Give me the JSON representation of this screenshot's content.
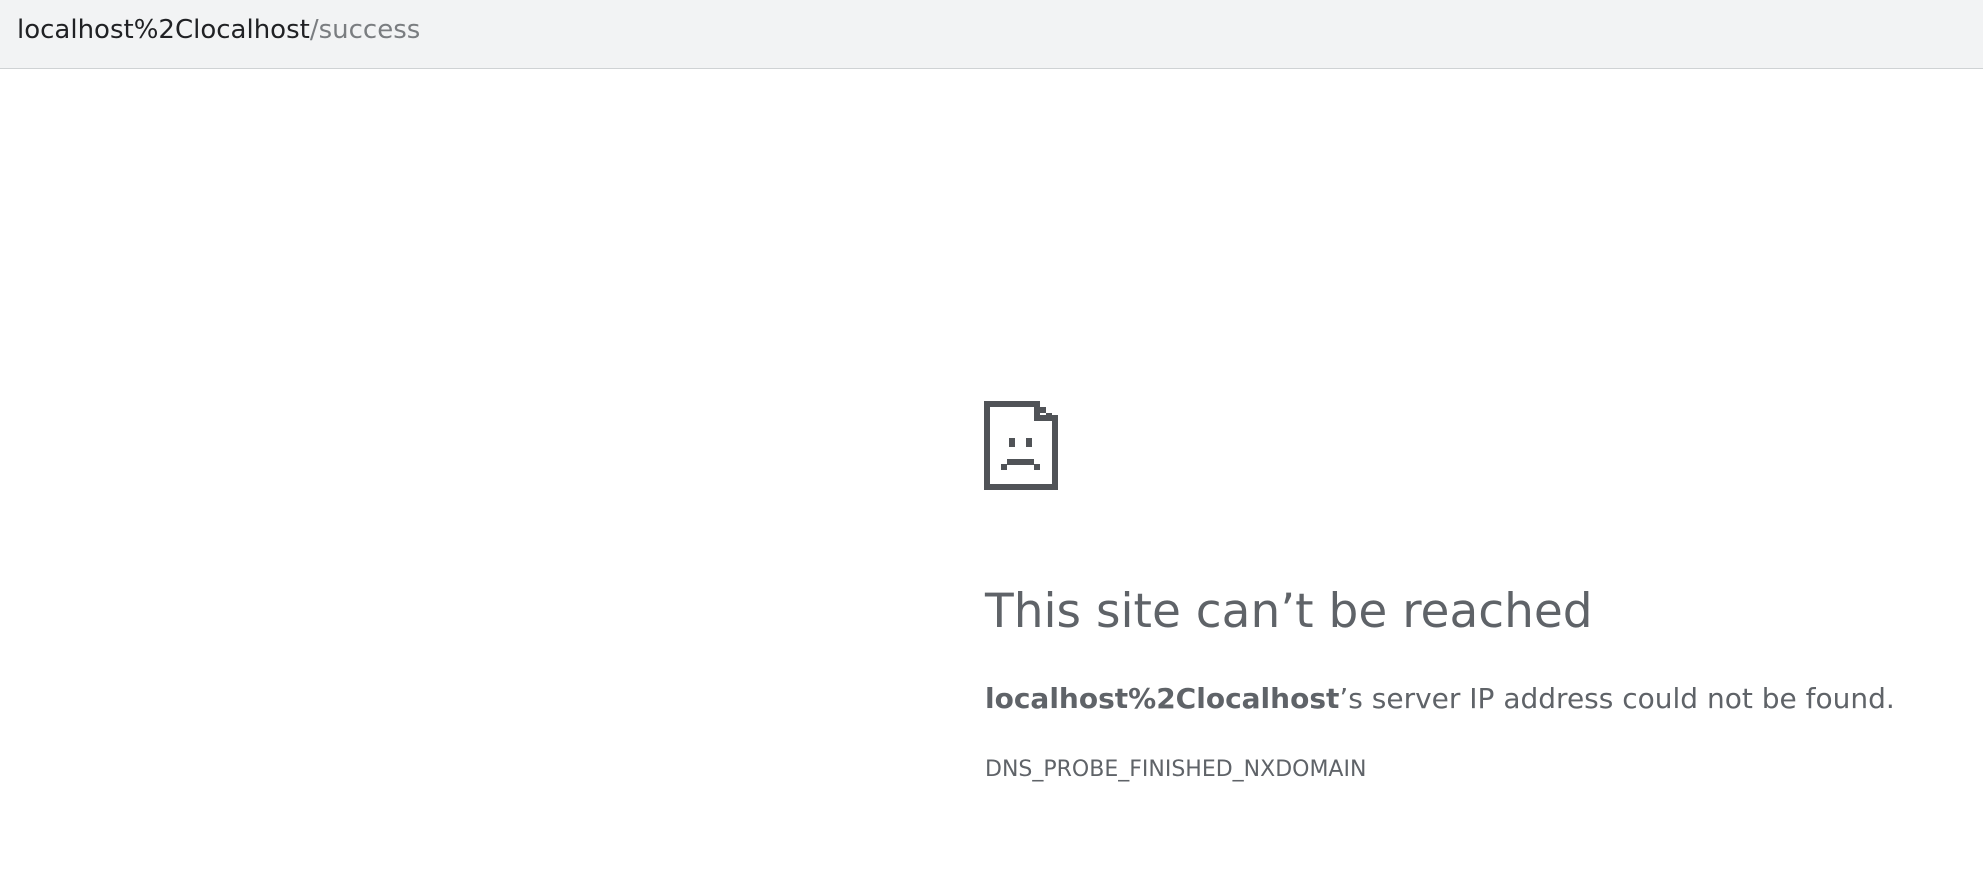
{
  "address_bar": {
    "url_host": "localhost%2Clocalhost",
    "url_path": "/success"
  },
  "error_page": {
    "icon": "sad-page-icon",
    "heading": "This site can’t be reached",
    "summary": {
      "host": "localhost%2Clocalhost",
      "message": "’s server IP address could not be found."
    },
    "error_code": "DNS_PROBE_FINISHED_NXDOMAIN",
    "colors": {
      "text": "#5f6368",
      "icon": "#505357",
      "address_bar_background": "#f2f3f4"
    }
  }
}
